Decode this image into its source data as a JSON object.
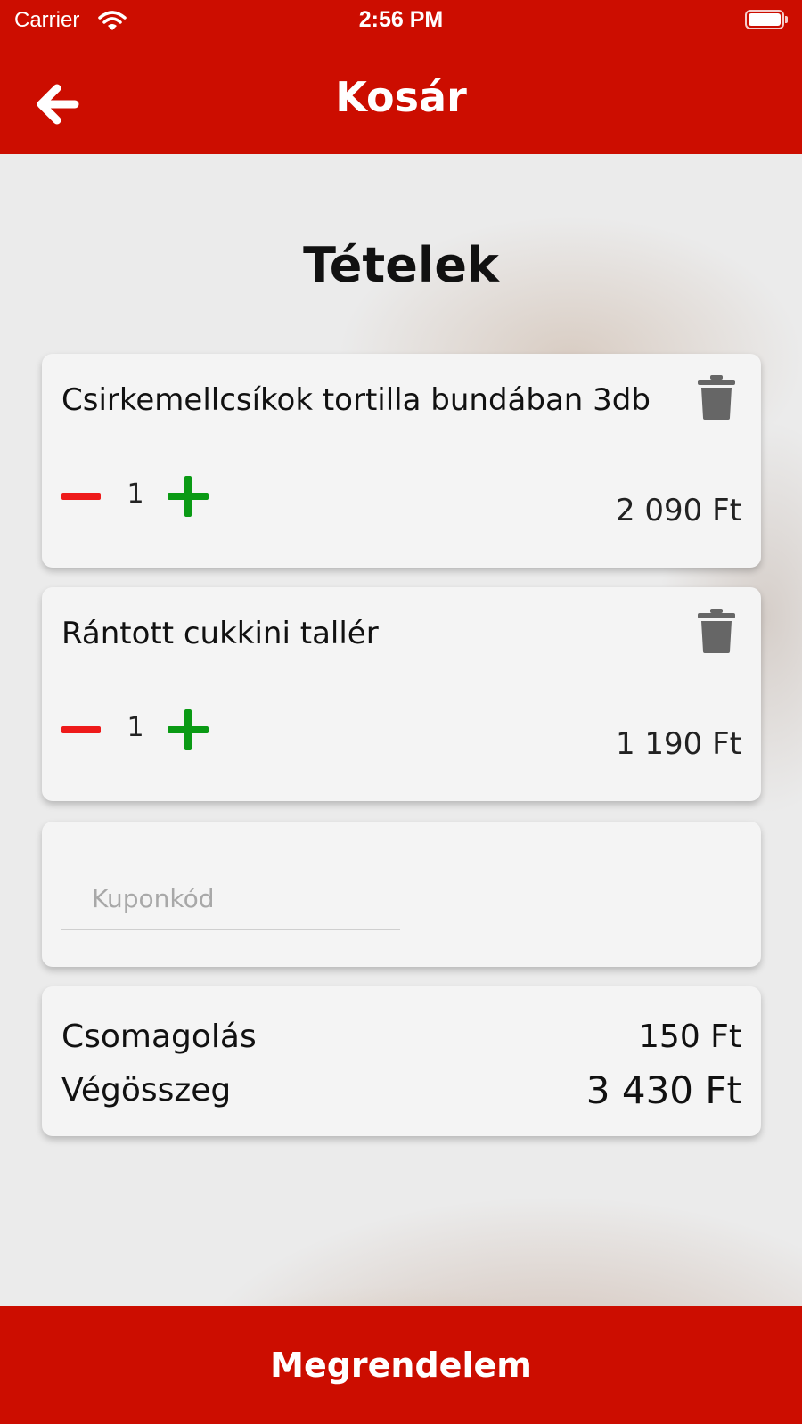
{
  "status_bar": {
    "carrier": "Carrier",
    "time": "2:56 PM"
  },
  "header": {
    "title": "Kosár",
    "back_icon": "arrow-left-icon"
  },
  "section_title": "Tételek",
  "cart_items": [
    {
      "name": "Csirkemellcsíkok tortilla bundában  3db",
      "quantity": "1",
      "price": "2 090 Ft"
    },
    {
      "name": "Rántott cukkini tallér",
      "quantity": "1",
      "price": "1 190 Ft"
    }
  ],
  "coupon": {
    "placeholder": "Kuponkód",
    "value": ""
  },
  "summary": {
    "packaging_label": "Csomagolás",
    "packaging_value": "150 Ft",
    "total_label": "Végösszeg",
    "total_value": "3 430 Ft"
  },
  "footer": {
    "order_label": "Megrendelem"
  },
  "colors": {
    "brand_red": "#cc0d00",
    "minus_red": "#ee1a1a",
    "plus_green": "#0a9a14",
    "trash_gray": "#666666"
  }
}
